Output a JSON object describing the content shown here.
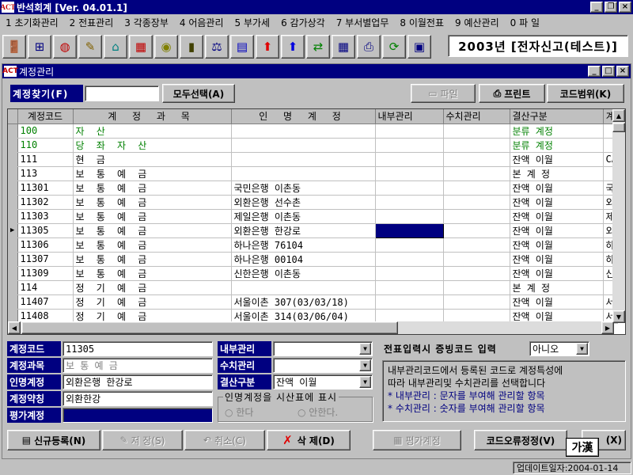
{
  "app": {
    "title": "반석회계 [Ver. 04.01.1]",
    "logo": "ACT"
  },
  "window_buttons": {
    "minimize": "_",
    "restore": "❐",
    "close": "×"
  },
  "menu": [
    "1 초기화관리",
    "2 전표관리",
    "3 각종장부",
    "4 어음관리",
    "5 부가세",
    "6 감가상각",
    "7 부서별업무",
    "8 이월전표",
    "9 예산관리",
    "0 파 일"
  ],
  "toolbar": {
    "icons": [
      "exit-door-icon",
      "tree-icon",
      "globe-icon",
      "pencil-icon",
      "tag-icon",
      "abacus-icon",
      "coin-icon",
      "book-icon",
      "scale-icon",
      "grid-icon",
      "arrow-up-red-icon",
      "arrow-up-blue-icon",
      "transfer-icon",
      "calculator-icon",
      "printer-icon",
      "refresh-icon",
      "monitor-icon"
    ],
    "glyphs": [
      "🚪",
      "⊞",
      "◍",
      "✎",
      "⌂",
      "▦",
      "◉",
      "▮",
      "⚖",
      "▤",
      "⬆",
      "⬆",
      "⇄",
      "▦",
      "⎙",
      "⟳",
      "▣"
    ],
    "year_label": "2003년 [전자신고(테스트)]"
  },
  "child": {
    "title": "계정관리",
    "search_label": "계정찾기(F)",
    "search_value": "",
    "select_all": "모두선택(A)",
    "btn_file": "파일",
    "btn_print": "프린트",
    "btn_code_range": "코드범위(K)"
  },
  "grid": {
    "columns": [
      "계정코드",
      "계 정 과 목",
      "인 명 계 정",
      "내부관리",
      "수치관리",
      "결산구분",
      "계"
    ],
    "rows": [
      {
        "code": "100",
        "name": "자      산",
        "person": "",
        "inner": "",
        "num": "",
        "close": "분류  계정",
        "extra": "",
        "style": "green"
      },
      {
        "code": "110",
        "name": "당 좌 자 산",
        "person": "",
        "inner": "",
        "num": "",
        "close": "분류  계정",
        "extra": "",
        "style": "green"
      },
      {
        "code": "111",
        "name": "현       금",
        "person": "",
        "inner": "",
        "num": "",
        "close": "잔액  이월",
        "extra": "CA",
        "style": ""
      },
      {
        "code": "113",
        "name": "보 통 예 금",
        "person": "",
        "inner": "",
        "num": "",
        "close": "본  계  정",
        "extra": "",
        "style": ""
      },
      {
        "code": "11301",
        "name": "보 통 예 금",
        "person": "국민은행 이촌동",
        "inner": "",
        "num": "",
        "close": "잔액  이월",
        "extra": "국",
        "style": ""
      },
      {
        "code": "11302",
        "name": "보 통 예 금",
        "person": "외환은행 선수촌",
        "inner": "",
        "num": "",
        "close": "잔액  이월",
        "extra": "외",
        "style": ""
      },
      {
        "code": "11303",
        "name": "보 통 예 금",
        "person": "제일은행 이촌동",
        "inner": "",
        "num": "",
        "close": "잔액  이월",
        "extra": "제",
        "style": ""
      },
      {
        "code": "11305",
        "name": "보 통 예 금",
        "person": "외환은행 한강로",
        "inner": "",
        "num": "",
        "close": "잔액  이월",
        "extra": "외",
        "style": "current"
      },
      {
        "code": "11306",
        "name": "보 통 예 금",
        "person": "하나은행 76104",
        "inner": "",
        "num": "",
        "close": "잔액  이월",
        "extra": "하",
        "style": ""
      },
      {
        "code": "11307",
        "name": "보 통 예 금",
        "person": "하나은행 00104",
        "inner": "",
        "num": "",
        "close": "잔액  이월",
        "extra": "하",
        "style": ""
      },
      {
        "code": "11309",
        "name": "보 통 예 금",
        "person": "신한은행 이촌동",
        "inner": "",
        "num": "",
        "close": "잔액  이월",
        "extra": "신",
        "style": ""
      },
      {
        "code": "114",
        "name": "정 기 예 금",
        "person": "",
        "inner": "",
        "num": "",
        "close": "본  계  정",
        "extra": "",
        "style": ""
      },
      {
        "code": "11407",
        "name": "정 기 예 금",
        "person": "서울이촌 307(03/03/18)",
        "inner": "",
        "num": "",
        "close": "잔액  이월",
        "extra": "서",
        "style": ""
      },
      {
        "code": "11408",
        "name": "정 기 예 금",
        "person": "서울이촌 314(03/06/04)",
        "inner": "",
        "num": "",
        "close": "잔액  이월",
        "extra": "서",
        "style": ""
      }
    ]
  },
  "form": {
    "code_label": "계정코드",
    "code_value": "11305",
    "subject_label": "계정과목",
    "subject_value": "보 통 예 금",
    "person_label": "인명계정",
    "person_value": "외환은행 한강로",
    "abbr_label": "계정약칭",
    "abbr_value": "외환한강",
    "eval_label": "평가계정",
    "eval_value": "",
    "inner_label": "내부관리",
    "inner_value": "",
    "num_label": "수치관리",
    "num_value": "",
    "close_label": "결산구분",
    "close_value": "잔액  이월",
    "trial_title": "인명계정을 시산표에 표시",
    "trial_yes": "한다",
    "trial_no": "안한다.",
    "voucher_label": "전표입력시 증빙코드 입력",
    "voucher_value": "아니오",
    "info_line1": "내부관리코드에서 등록된 코드로 계정특성에",
    "info_line2": "따라 내부관리및 수치관리를 선택합니다",
    "info_line3": "* 내부관리 : 문자를 부여해 관리할 항목",
    "info_line4": "* 수치관리 : 숫자를 부여해 관리할 항목"
  },
  "buttons": {
    "new": "신규등록(N)",
    "save": "저 장(S)",
    "cancel": "취소(C)",
    "delete": "삭 제(D)",
    "eval": "평가계정",
    "fix": "코드오류정정(V)",
    "close": "(X)",
    "ime": "가漢"
  },
  "status": {
    "update": "업데이트일자:2004-01-14"
  }
}
